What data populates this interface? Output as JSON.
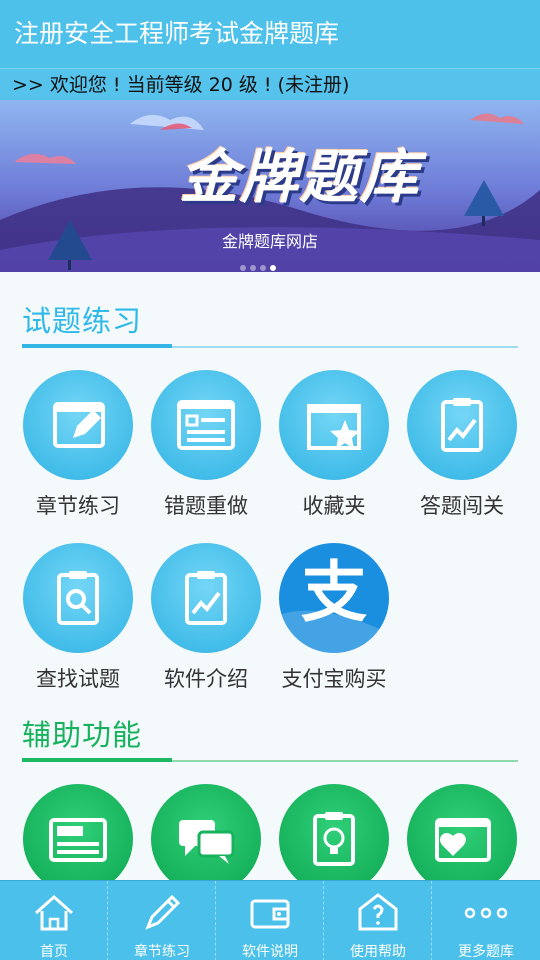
{
  "app": {
    "title": "注册安全工程师考试金牌题库"
  },
  "notice": {
    "text": ">> 欢迎您 ! 当前等级 20 级 ! (未注册)"
  },
  "banner": {
    "title": "金牌题库",
    "caption": "金牌题库网店",
    "slides": 4,
    "active_slide": 4
  },
  "practice": {
    "heading": "试题练习",
    "tiles": [
      {
        "label": "章节练习",
        "icon": "pencil-doc-icon"
      },
      {
        "label": "错题重做",
        "icon": "form-check-icon"
      },
      {
        "label": "收藏夹",
        "icon": "star-folder-icon"
      },
      {
        "label": "答题闯关",
        "icon": "clipboard-chart-icon"
      },
      {
        "label": "查找试题",
        "icon": "clipboard-search-icon"
      },
      {
        "label": "软件介绍",
        "icon": "clipboard-chart-icon"
      },
      {
        "label": "支付宝购买",
        "icon": "alipay-icon"
      }
    ]
  },
  "tools": {
    "heading": "辅助功能",
    "tiles": [
      {
        "icon": "news-icon"
      },
      {
        "icon": "chat-icon"
      },
      {
        "icon": "clipboard-bulb-icon"
      },
      {
        "icon": "heart-window-icon"
      }
    ]
  },
  "alipay_glyph": "支",
  "bottom_nav": [
    {
      "label": "首页",
      "icon": "home-icon"
    },
    {
      "label": "章节练习",
      "icon": "pencil-icon"
    },
    {
      "label": "软件说明",
      "icon": "wallet-icon"
    },
    {
      "label": "使用帮助",
      "icon": "help-mail-icon"
    },
    {
      "label": "更多题库",
      "icon": "more-dots-icon"
    }
  ],
  "colors": {
    "primary": "#4dc1ea",
    "accent_blue": "#33b6e6",
    "accent_green": "#1db863",
    "alipay": "#1a8fe0"
  }
}
